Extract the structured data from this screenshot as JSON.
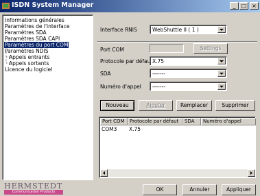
{
  "window": {
    "title": "ISDN System Manager",
    "min": "_",
    "max": "□",
    "close": "×"
  },
  "tree": {
    "items": [
      {
        "label": "Informations générales",
        "level": 0,
        "selected": false
      },
      {
        "label": "Paramètres de l'interface",
        "level": 0,
        "selected": false
      },
      {
        "label": "Paramètres SDA",
        "level": 0,
        "selected": false
      },
      {
        "label": "Paramètres SDA CAPI",
        "level": 0,
        "selected": false
      },
      {
        "label": "Paramètres du port COM",
        "level": 0,
        "selected": true
      },
      {
        "label": "Paramètres NDIS",
        "level": 0,
        "selected": false
      },
      {
        "label": "Appels entrants",
        "level": 1,
        "selected": false
      },
      {
        "label": "Appels sortants",
        "level": 1,
        "selected": false
      },
      {
        "label": "Licence du logiciel",
        "level": 0,
        "selected": false
      }
    ]
  },
  "form": {
    "interface_label": "Interface RNIS",
    "interface_value": "WebShuttle II  ( 1 )",
    "port_label": "Port COM",
    "settings_label": "Settings",
    "protocol_label": "Protocole par défaut",
    "protocol_value": "X.75",
    "sda_label": "SDA",
    "sda_value": "-------",
    "number_label": "Numéro d'appel",
    "number_value": "-------"
  },
  "actions": {
    "new": "Nouveau",
    "add": "Ajouter",
    "replace": "Remplacer",
    "delete": "Supprimer"
  },
  "list": {
    "headers": [
      "Port COM",
      "Protocole par défaut",
      "SDA",
      "Numéro d'appel"
    ],
    "rows": [
      {
        "port": "COM3",
        "protocol": "X.75"
      }
    ]
  },
  "footer": {
    "logo": "HERMSTEDT",
    "logo_sub": "Communication Products",
    "ok": "OK",
    "cancel": "Annuler",
    "apply": "Appliquer"
  }
}
